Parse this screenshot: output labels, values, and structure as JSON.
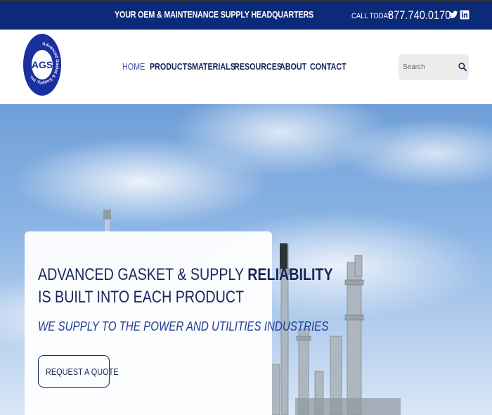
{
  "topbar": {
    "tagline": "YOUR OEM & MAINTENANCE SUPPLY HEADQUARTERS",
    "call_label": "CALL TODAY",
    "phone": "877.740.0170",
    "social_icons": [
      "twitter-icon",
      "linkedin-icon"
    ]
  },
  "logo": {
    "ring_text": "Advanced Gasket & Supply, Inc.",
    "initials": "AGS"
  },
  "nav": {
    "items": [
      {
        "label": "HOME",
        "active": true
      },
      {
        "label": "PRODUCTS",
        "active": false
      },
      {
        "label": "MATERIALS",
        "active": false
      },
      {
        "label": "RESOURCES",
        "active": false
      },
      {
        "label": "ABOUT",
        "active": false
      },
      {
        "label": "CONTACT",
        "active": false
      }
    ]
  },
  "search": {
    "placeholder": "Search",
    "icon": "search-icon"
  },
  "hero": {
    "headline_line1_plain": "ADVANCED GASKET & SUPPLY ",
    "headline_line1_bold": "RELIABILITY",
    "headline_line2": "IS BUILT INTO EACH PRODUCT",
    "subline": "WE SUPPLY TO THE POWER AND UTILITIES INDUSTRIES",
    "cta_label": "REQUEST A QUOTE"
  },
  "colors": {
    "brand_navy": "#0c2a7a",
    "text_navy": "#1b2559",
    "nav_active": "#3d58a6",
    "subline_blue": "#1e3a94"
  }
}
